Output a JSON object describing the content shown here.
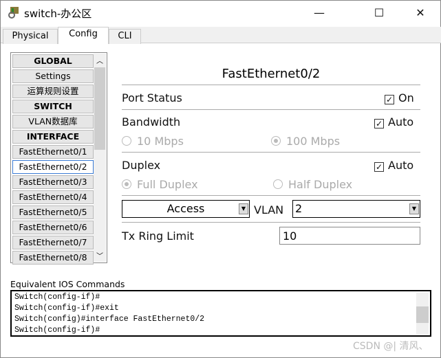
{
  "window": {
    "title": "switch-办公区",
    "minimize": "—",
    "maximize": "☐",
    "close": "✕"
  },
  "tabs": [
    {
      "label": "Physical"
    },
    {
      "label": "Config"
    },
    {
      "label": "CLI"
    }
  ],
  "sidebar": {
    "items": [
      {
        "label": "GLOBAL",
        "header": true
      },
      {
        "label": "Settings"
      },
      {
        "label": "运算规则设置"
      },
      {
        "label": "SWITCH",
        "header": true
      },
      {
        "label": "VLAN数据库"
      },
      {
        "label": "INTERFACE",
        "header": true
      },
      {
        "label": "FastEthernet0/1"
      },
      {
        "label": "FastEthernet0/2",
        "selected": true
      },
      {
        "label": "FastEthernet0/3"
      },
      {
        "label": "FastEthernet0/4"
      },
      {
        "label": "FastEthernet0/5"
      },
      {
        "label": "FastEthernet0/6"
      },
      {
        "label": "FastEthernet0/7"
      },
      {
        "label": "FastEthernet0/8"
      }
    ]
  },
  "panel": {
    "title": "FastEthernet0/2",
    "port_status": {
      "label": "Port Status",
      "check_label": "On",
      "checked": true
    },
    "bandwidth": {
      "label": "Bandwidth",
      "check_label": "Auto",
      "checked": true,
      "opt1": "10 Mbps",
      "opt2": "100 Mbps",
      "selected": "100 Mbps"
    },
    "duplex": {
      "label": "Duplex",
      "check_label": "Auto",
      "checked": true,
      "opt1": "Full Duplex",
      "opt2": "Half Duplex",
      "selected": "Full Duplex"
    },
    "mode": "Access",
    "vlan_label": "VLAN",
    "vlan": "2",
    "tx_label": "Tx Ring Limit",
    "tx_value": "10"
  },
  "console": {
    "label": "Equivalent IOS Commands",
    "lines": [
      "Switch(config-if)#",
      "Switch(config-if)#exit",
      "Switch(config)#interface FastEthernet0/2",
      "Switch(config-if)#"
    ]
  },
  "watermark": "CSDN @| 清风、"
}
